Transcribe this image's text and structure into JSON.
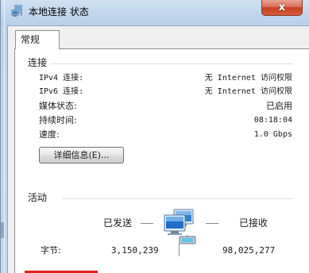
{
  "window": {
    "title": "本地连接 状态",
    "close_label": "x"
  },
  "tabs": [
    {
      "label": "常规"
    }
  ],
  "connection": {
    "section_title": "连接",
    "rows": [
      {
        "label": "IPv4 连接:",
        "value": "无 Internet 访问权限"
      },
      {
        "label": "IPv6 连接:",
        "value": "无 Internet 访问权限"
      },
      {
        "label": "媒体状态:",
        "value": "已启用"
      },
      {
        "label": "持续时间:",
        "value": "08:18:04"
      },
      {
        "label": "速度:",
        "value": "1.0 Gbps"
      }
    ],
    "details_button": "详细信息(E)..."
  },
  "activity": {
    "section_title": "活动",
    "sent_label": "已发送",
    "received_label": "已接收",
    "bytes_label": "字节:",
    "bytes_sent": "3,150,239",
    "bytes_received": "98,025,277"
  },
  "icons": {
    "title": "network-connection-icon",
    "activity": "network-computers-icon"
  },
  "colors": {
    "close_button": "#c43f22",
    "frame": "#bcd3ec",
    "highlight_bar": "#e0201c"
  }
}
